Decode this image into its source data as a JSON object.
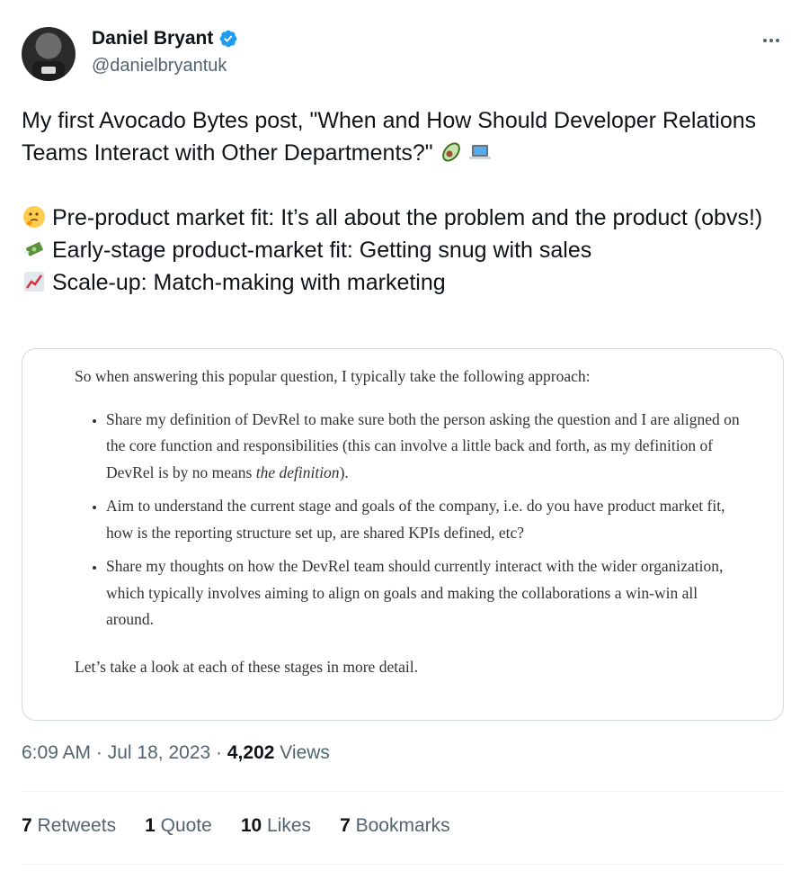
{
  "author": {
    "display_name": "Daniel Bryant",
    "handle": "@danielbryantuk",
    "verified_color": "#1d9bf0"
  },
  "tweet": {
    "line1": "My first Avocado Bytes post, \"When and How Should Developer Relations Teams Interact with Other Departments?\"",
    "line1_emojis": [
      "avocado",
      "laptop"
    ],
    "items": [
      {
        "emoji": "thinking-face",
        "text": "Pre-product market fit: It’s all about the problem and the product (obvs!)"
      },
      {
        "emoji": "money-with-wings",
        "text": "Early-stage product-market fit: Getting snug with sales"
      },
      {
        "emoji": "chart-increasing",
        "text": "Scale-up: Match-making with marketing"
      }
    ]
  },
  "media": {
    "intro": "So when answering this popular question, I typically take the following approach:",
    "bullets": [
      {
        "text": "Share my definition of DevRel to make sure both the person asking the question and I are aligned on the core function and responsibilities (this can involve a little back and forth, as my definition of DevRel is by no means ",
        "italic": "the definition",
        "after": ")."
      },
      {
        "text": "Aim to understand the current stage and goals of the company, i.e. do you have product market fit, how is the reporting structure set up, are shared KPIs defined, etc?"
      },
      {
        "text": "Share my thoughts on how the DevRel team should currently interact with the wider organization, which typically involves aiming to align on goals and making the collaborations a win-win all around."
      }
    ],
    "closing": "Let’s take a look at each of these stages in more detail."
  },
  "meta": {
    "time": "6:09 AM",
    "date": "Jul 18, 2023",
    "views_count": "4,202",
    "views_label": "Views",
    "separator": "·"
  },
  "stats": {
    "retweets_count": "7",
    "retweets_label": "Retweets",
    "quotes_count": "1",
    "quotes_label": "Quote",
    "likes_count": "10",
    "likes_label": "Likes",
    "bookmarks_count": "7",
    "bookmarks_label": "Bookmarks"
  },
  "colors": {
    "text_primary": "#0f1419",
    "text_secondary": "#536471",
    "border": "#cfd9de",
    "divider": "#eff3f4"
  }
}
